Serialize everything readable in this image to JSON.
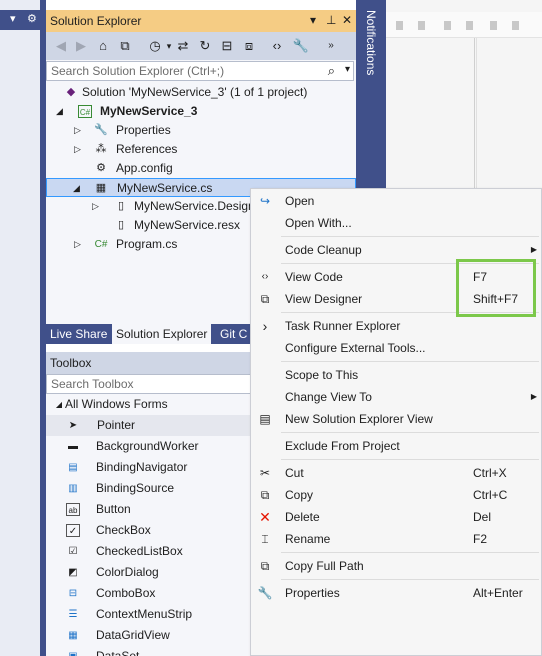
{
  "solution_explorer": {
    "title": "Solution Explorer",
    "search_placeholder": "Search Solution Explorer (Ctrl+;)",
    "tree": [
      {
        "label": "Solution 'MyNewService_3' (1 of 1 project)",
        "icon": "solution-icon"
      },
      {
        "label": "MyNewService_3",
        "icon": "csharp-project-icon"
      },
      {
        "label": "Properties",
        "icon": "wrench-icon"
      },
      {
        "label": "References",
        "icon": "references-icon"
      },
      {
        "label": "App.config",
        "icon": "config-icon"
      },
      {
        "label": "MyNewService.cs",
        "icon": "component-icon"
      },
      {
        "label": "MyNewService.Designer.cs",
        "icon": "file-icon"
      },
      {
        "label": "MyNewService.resx",
        "icon": "file-icon"
      },
      {
        "label": "Program.cs",
        "icon": "csharp-file-icon"
      }
    ],
    "tabs": [
      "Live Share",
      "Solution Explorer",
      "Git C"
    ]
  },
  "notifications_label": "Notifications",
  "toolbox": {
    "title": "Toolbox",
    "search_placeholder": "Search Toolbox",
    "group": "All Windows Forms",
    "items": [
      "Pointer",
      "BackgroundWorker",
      "BindingNavigator",
      "BindingSource",
      "Button",
      "CheckBox",
      "CheckedListBox",
      "ColorDialog",
      "ComboBox",
      "ContextMenuStrip",
      "DataGridView",
      "DataSet"
    ]
  },
  "context_menu": {
    "items": [
      {
        "label": "Open",
        "icon": "open-icon",
        "shortcut": ""
      },
      {
        "label": "Open With...",
        "icon": "",
        "shortcut": ""
      },
      {
        "label": "Code Cleanup",
        "icon": "",
        "shortcut": "",
        "submenu": true
      },
      {
        "label": "View Code",
        "icon": "view-code-icon",
        "shortcut": "F7"
      },
      {
        "label": "View Designer",
        "icon": "view-designer-icon",
        "shortcut": "Shift+F7"
      },
      {
        "label": "Task Runner Explorer",
        "icon": "task-runner-icon",
        "shortcut": ""
      },
      {
        "label": "Configure External Tools...",
        "icon": "",
        "shortcut": ""
      },
      {
        "label": "Scope to This",
        "icon": "",
        "shortcut": ""
      },
      {
        "label": "Change View To",
        "icon": "",
        "shortcut": "",
        "submenu": true
      },
      {
        "label": "New Solution Explorer View",
        "icon": "new-view-icon",
        "shortcut": ""
      },
      {
        "label": "Exclude From Project",
        "icon": "",
        "shortcut": ""
      },
      {
        "label": "Cut",
        "icon": "scissors-icon",
        "shortcut": "Ctrl+X"
      },
      {
        "label": "Copy",
        "icon": "copy-icon",
        "shortcut": "Ctrl+C"
      },
      {
        "label": "Delete",
        "icon": "delete-icon",
        "shortcut": "Del"
      },
      {
        "label": "Rename",
        "icon": "rename-icon",
        "shortcut": "F2"
      },
      {
        "label": "Copy Full Path",
        "icon": "copy-path-icon",
        "shortcut": ""
      },
      {
        "label": "Properties",
        "icon": "wrench-icon",
        "shortcut": "Alt+Enter"
      }
    ]
  },
  "colors": {
    "frame": "#40508a",
    "title_active": "#f5cc84",
    "selection": "#c9d8f2",
    "highlight_box": "#7cc84a",
    "delete_red": "#e51400"
  }
}
